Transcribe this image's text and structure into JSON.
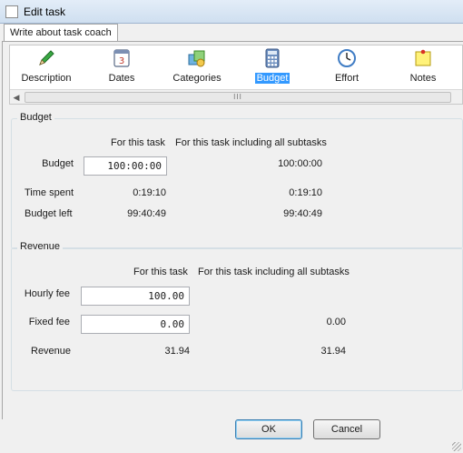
{
  "window": {
    "title": "Edit task"
  },
  "tab": {
    "label": "Write about task coach"
  },
  "toolbar": {
    "items": [
      {
        "label": "Description",
        "icon": "pencil-icon"
      },
      {
        "label": "Dates",
        "icon": "calendar-icon"
      },
      {
        "label": "Categories",
        "icon": "categories-icon"
      },
      {
        "label": "Budget",
        "icon": "calculator-icon",
        "selected": true
      },
      {
        "label": "Effort",
        "icon": "clock-icon"
      },
      {
        "label": "Notes",
        "icon": "sticky-note-icon"
      }
    ],
    "scrollbar": {
      "left_arrow": "◀",
      "thumb_grip": "III"
    }
  },
  "budget": {
    "title": "Budget",
    "col_task": "For this task",
    "col_sub": "For this task including all subtasks",
    "rows": {
      "budget": {
        "label": "Budget",
        "value": "100:00:00",
        "sub": "100:00:00"
      },
      "spent": {
        "label": "Time spent",
        "value": "0:19:10",
        "sub": "0:19:10"
      },
      "left": {
        "label": "Budget left",
        "value": "99:40:49",
        "sub": "99:40:49"
      }
    }
  },
  "revenue": {
    "title": "Revenue",
    "col_task": "For this task",
    "col_sub": "For this task including all subtasks",
    "rows": {
      "hourly": {
        "label": "Hourly fee",
        "value": "100.00"
      },
      "fixed": {
        "label": "Fixed fee",
        "value": "0.00",
        "sub": "0.00"
      },
      "revenue": {
        "label": "Revenue",
        "value": "31.94",
        "sub": "31.94"
      }
    }
  },
  "buttons": {
    "ok": "OK",
    "cancel": "Cancel"
  }
}
